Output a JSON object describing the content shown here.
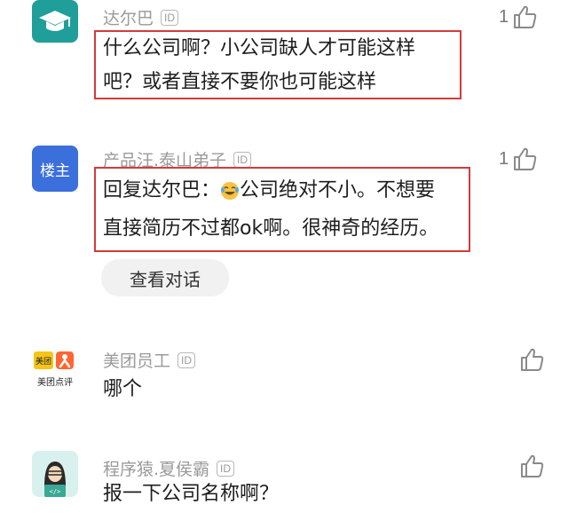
{
  "comments": [
    {
      "author": "达尔巴",
      "id_badge": "ID",
      "text_lines": [
        "什么公司啊？小公司缺人才可能这样",
        "吧？或者直接不要你也可能这样"
      ],
      "likes": "1"
    },
    {
      "avatar_label": "楼主",
      "author": "产品汪.泰山弟子",
      "id_badge": "ID",
      "reply_prefix": "回复达尔巴：",
      "text_line1_rest": "公司绝对不小。不想要",
      "text_line2": "直接简历不过都ok啊。很神奇的经历。",
      "likes": "1",
      "view_dialog_label": "查看对话"
    },
    {
      "avatar_label_top": "美团",
      "avatar_label_bottom": "美团点评",
      "author": "美团员工",
      "id_badge": "ID",
      "text": "哪个"
    },
    {
      "author": "程序猿.夏侯霸",
      "id_badge": "ID",
      "text": "报一下公司名称啊？"
    }
  ],
  "colors": {
    "highlight_border": "#d63a3a",
    "teal_avatar": "#1f9e9a",
    "blue_avatar": "#3b6fdc",
    "meituan_yellow": "#f5c518",
    "dianping_orange": "#ff6633"
  }
}
